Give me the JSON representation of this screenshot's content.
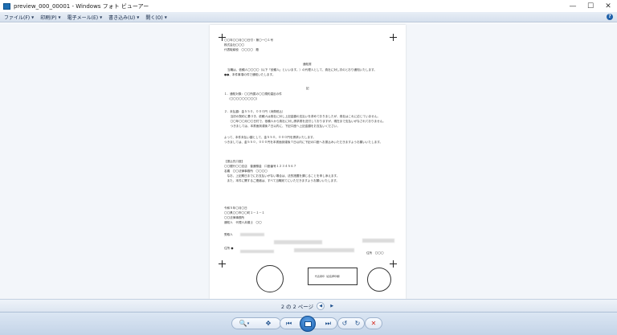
{
  "window": {
    "title": "preview_000_00001 - Windows フォト ビューアー",
    "minimize": "—",
    "maximize": "☐",
    "close": "✕"
  },
  "menu": {
    "items": [
      {
        "label": "ファイル(F)"
      },
      {
        "label": "印刷(P)"
      },
      {
        "label": "電子メール(E)"
      },
      {
        "label": "書き込み(U)"
      },
      {
        "label": "開く(O)"
      }
    ],
    "help": "?"
  },
  "document": {
    "lines": [
      "〇〇年〇〇月〇〇日付・第〇一〇１号",
      "株式会社〇〇〇",
      "代表取締役　〇〇〇〇　殿",
      "通知書",
      "当職は、依頼人〇〇〇〇（以下「依頼人」といいます。）の代理人として、貴社に対し次のとおり通知いたします。",
      "●●、本件事項の件で通知いたします。",
      "記",
      "１．通知対象：〇〇所属の〇〇規約違反の件",
      "（〇〇〇〇〇〇〇〇〇）",
      "２．未払額：金５５０，０００円（消費税込）",
      "　当初の契約に基づき、依頼人は貴社に対し上記金額の支払いを求めておりましたが、貴社はこれに応じていません。",
      "　〇〇年〇〇月〇〇日付で、依頼人から貴社に対し請求書を送付しておりますが、現在まで支払いがなされておりません。",
      "　つきましては、本書面到達後７日以内に、下記口座へ上記金額をお支払いください。",
      "よって、本件未払い額として、金５５０，０００円を請求いたします。",
      "つきましては、金５５０，０００円を本書面到達後７日以内に下記の口座へお振込みいただきますようお願いいたします。",
      "【振込先口座】",
      "〇〇銀行〇〇支店　普通預金　口座番号１２３４５６７",
      "名義　〇〇法律事務所　〇〇〇〇",
      "　なお、上記期日までにお支払いがない場合は、法的措置を講じることを申し添えます。",
      "　また、本件に関するご連絡は、すべて当職宛てにいただきますようお願いいたします。",
      "令和５年〇月〇日",
      "〇〇県〇〇市〇〇町１－１－１",
      "〇〇法律事務所",
      "通知人　代理人弁護士　〇〇",
      "受取人　",
      "住所　〇〇〇",
      "住所 ●",
      "代表者印"
    ],
    "stamp_box": "代表者印（記名押印欄）"
  },
  "pagebar": {
    "indicator": "2 の 2 ページ",
    "prev": "◀",
    "next": "▶"
  },
  "toolbar": {
    "zoom": "🔍",
    "zoom_dropdown": "▾",
    "fit": "✥",
    "prev": "⏮",
    "next": "⏭",
    "rotate_left": "↺",
    "rotate_right": "↻",
    "delete": "✕"
  },
  "colors": {
    "accent": "#1d5fa8",
    "delete": "#d42a1f"
  }
}
